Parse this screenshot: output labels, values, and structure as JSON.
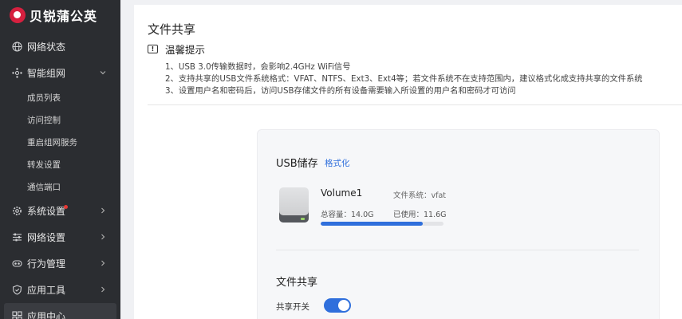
{
  "brand": {
    "name": "贝锐蒲公英",
    "color": "#d6203f"
  },
  "sidebar": {
    "items": [
      {
        "label": "网络状态",
        "icon": "globe-icon"
      },
      {
        "label": "智能组网",
        "icon": "network-nodes-icon",
        "expanded": true,
        "children": [
          "成员列表",
          "访问控制",
          "重启组网服务",
          "转发设置",
          "通信端口"
        ]
      },
      {
        "label": "系统设置",
        "icon": "gear-icon",
        "badge": "red-dot"
      },
      {
        "label": "网络设置",
        "icon": "sliders-icon"
      },
      {
        "label": "行为管理",
        "icon": "behavior-icon"
      },
      {
        "label": "应用工具",
        "icon": "shield-icon"
      },
      {
        "label": "应用中心",
        "icon": "apps-grid-icon",
        "active": true
      }
    ]
  },
  "main": {
    "title": "文件共享",
    "tips": {
      "heading": "温馨提示",
      "lines": [
        "1、USB 3.0传输数据时，会影响2.4GHz WiFi信号",
        "2、支持共享的USB文件系统格式：VFAT、NTFS、Ext3、Ext4等；若文件系统不在支持范围内，建议格式化成支持共享的文件系统",
        "3、设置用户名和密码后，访问USB存储文件的所有设备需要输入所设置的用户名和密码才可访问"
      ]
    },
    "usb": {
      "title": "USB储存",
      "format_link": "格式化",
      "volume_name": "Volume1",
      "filesystem": "文件系统：vfat",
      "capacity": "总容量：14.0G",
      "used": "已使用：11.6G",
      "usage_fraction": 0.83,
      "bar_color": "#2f6fdc"
    },
    "share": {
      "title": "文件共享",
      "switch_label": "共享开关",
      "enabled": true
    }
  }
}
